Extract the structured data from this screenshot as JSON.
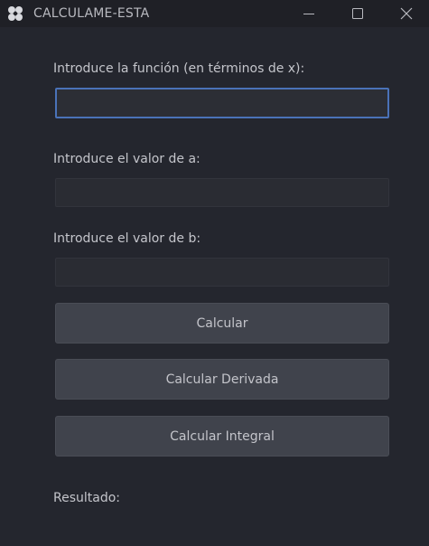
{
  "window": {
    "title": "CALCULAME-ESTA",
    "icon": "app-logo-icon",
    "controls": [
      "minimize-icon",
      "maximize-icon",
      "close-icon"
    ]
  },
  "form": {
    "function_label": "Introduce la función (en términos de x):",
    "function_value": "",
    "a_label": "Introduce el valor de a:",
    "a_value": "",
    "b_label": "Introduce el valor de b:",
    "b_value": ""
  },
  "buttons": {
    "calcular": "Calcular",
    "derivada": "Calcular Derivada",
    "integral": "Calcular Integral"
  },
  "result": {
    "label": "Resultado:"
  },
  "colors": {
    "background": "#24262e",
    "titlebar": "#1f2026",
    "button": "#40434c",
    "focus_border": "#4a72b8"
  }
}
